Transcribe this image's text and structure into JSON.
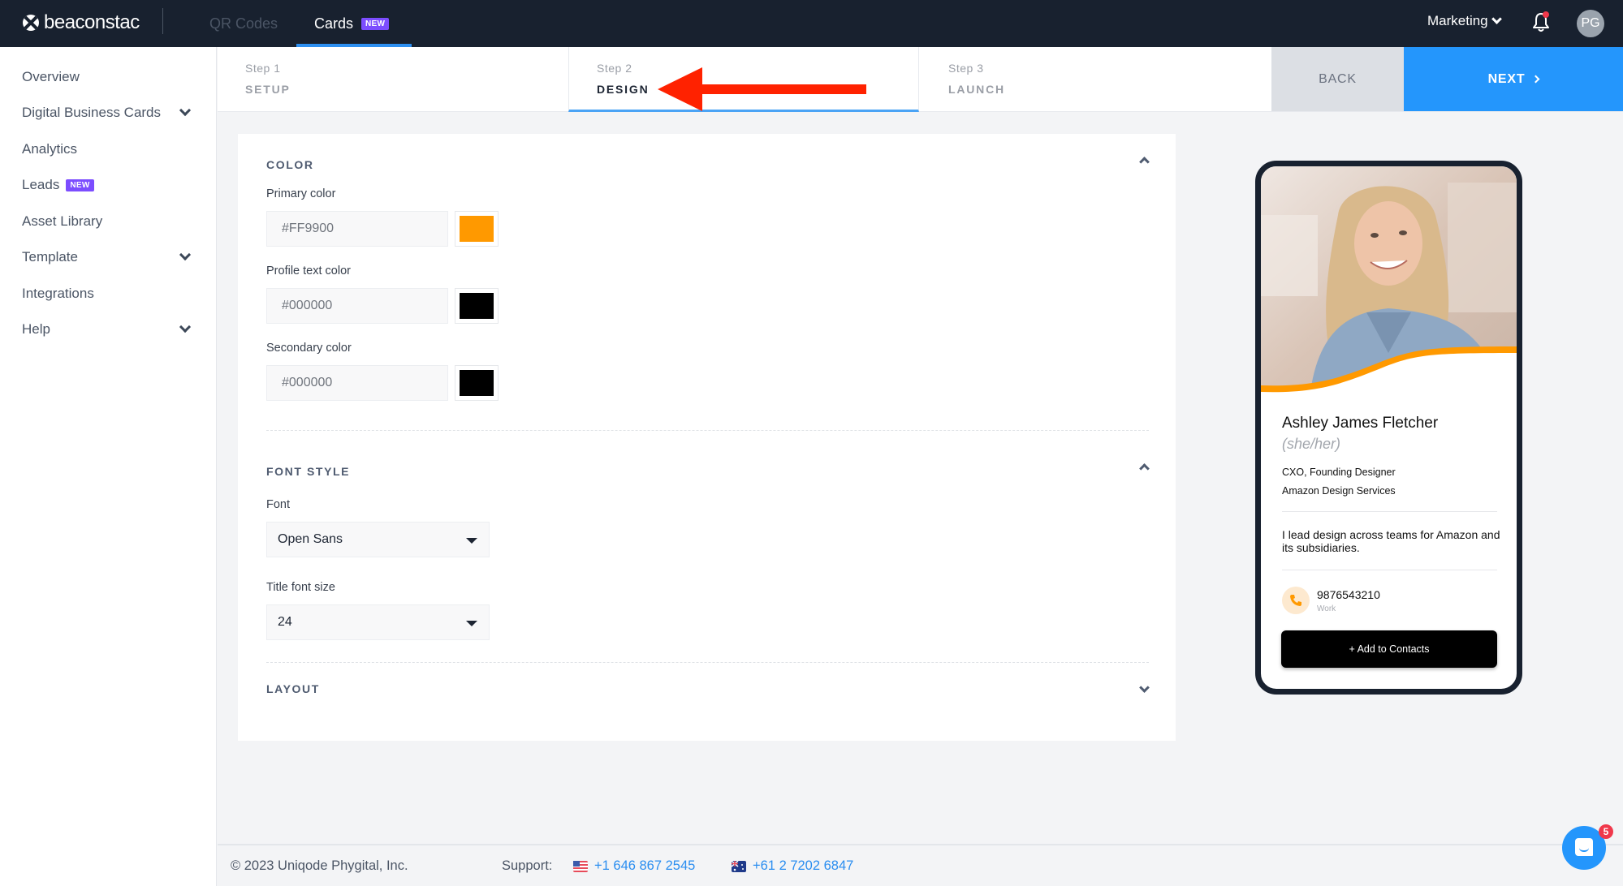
{
  "topbar": {
    "logo_text": "beaconstac",
    "tabs": [
      {
        "label": "QR Codes",
        "active": false
      },
      {
        "label": "Cards",
        "active": true,
        "badge": "NEW"
      }
    ],
    "org_selector": "Marketing",
    "avatar_initials": "PG",
    "notification_dot": true
  },
  "sidebar": {
    "items": [
      {
        "label": "Overview",
        "expandable": false
      },
      {
        "label": "Digital Business Cards",
        "expandable": true
      },
      {
        "label": "Analytics",
        "expandable": false
      },
      {
        "label": "Leads",
        "expandable": false,
        "badge": "NEW"
      },
      {
        "label": "Asset Library",
        "expandable": false
      },
      {
        "label": "Template",
        "expandable": true
      },
      {
        "label": "Integrations",
        "expandable": false
      },
      {
        "label": "Help",
        "expandable": true
      }
    ]
  },
  "steps": [
    {
      "num": "Step 1",
      "name": "SETUP",
      "active": false
    },
    {
      "num": "Step 2",
      "name": "DESIGN",
      "active": true
    },
    {
      "num": "Step 3",
      "name": "LAUNCH",
      "active": false
    }
  ],
  "actions": {
    "back_label": "BACK",
    "next_label": "NEXT"
  },
  "annotation": {
    "type": "arrow",
    "color": "#FF2200",
    "points_to": "DESIGN"
  },
  "design": {
    "color_section": {
      "title": "COLOR",
      "expanded": true,
      "fields": [
        {
          "label": "Primary color",
          "value": "#FF9900",
          "swatch": "#FF9900"
        },
        {
          "label": "Profile text color",
          "value": "#000000",
          "swatch": "#000000"
        },
        {
          "label": "Secondary color",
          "value": "#000000",
          "swatch": "#000000"
        }
      ]
    },
    "font_section": {
      "title": "FONT STYLE",
      "expanded": true,
      "font_label": "Font",
      "font_value": "Open Sans",
      "size_label": "Title font size",
      "size_value": "24"
    },
    "layout_section": {
      "title": "LAYOUT",
      "expanded": false
    }
  },
  "preview": {
    "name": "Ashley James Fletcher",
    "pronouns": "(she/her)",
    "title": "CXO, Founding Designer",
    "company": "Amazon Design Services",
    "bio": "I lead design across teams for Amazon and its subsidiaries.",
    "phone": "9876543210",
    "phone_type": "Work",
    "add_contact_label": "+ Add to Contacts",
    "accent_color": "#FF9900"
  },
  "footer": {
    "copyright": "© 2023 Uniqode Phygital, Inc.",
    "support_label": "Support:",
    "phones": [
      {
        "flag": "us-flag",
        "number": "+1 646 867 2545"
      },
      {
        "flag": "au-flag",
        "number": "+61 2 7202 6847"
      }
    ]
  },
  "chat": {
    "unread_count": "5"
  }
}
